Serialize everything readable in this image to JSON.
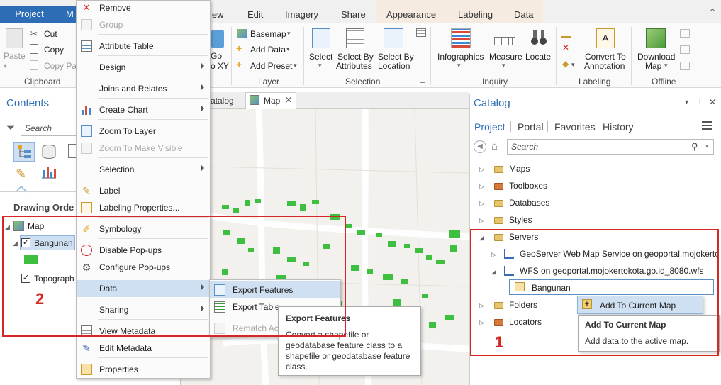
{
  "ribbon": {
    "tabs": {
      "project": "Project",
      "map_partial": "M",
      "view_partial": "iew",
      "edit": "Edit",
      "imagery": "Imagery",
      "share": "Share",
      "appearance": "Appearance",
      "labeling": "Labeling",
      "data": "Data"
    },
    "clipboard": {
      "paste": "Paste",
      "cut": "Cut",
      "copy": "Copy",
      "copy_path": "Copy Pat",
      "group": "Clipboard"
    },
    "navigate": {
      "go_partial": "Go",
      "to_xy_partial": "o XY"
    },
    "layer": {
      "basemap": "Basemap",
      "add_data": "Add Data",
      "add_preset": "Add Preset",
      "group": "Layer"
    },
    "selection": {
      "select": "Select",
      "select_by": "Select By",
      "attributes": "Attributes",
      "location": "Location",
      "group": "Selection"
    },
    "inquiry": {
      "infographics": "Infographics",
      "measure": "Measure",
      "locate": "Locate",
      "group": "Inquiry"
    },
    "labeling": {
      "convert_to": "Convert To",
      "annotation": "Annotation",
      "group": "Labeling"
    },
    "offline": {
      "download": "Download",
      "map": "Map",
      "group": "Offline"
    }
  },
  "contents": {
    "title": "Contents",
    "search_placeholder": "Search",
    "drawing_order": "Drawing Orde",
    "map": "Map",
    "layer_bangunan": "Bangunan",
    "layer_topographic": "Topograph"
  },
  "mapview": {
    "tab_catalog_partial": "atalog",
    "tab_map": "Map"
  },
  "context_menu": {
    "items": [
      {
        "label": "Remove",
        "disabled": false
      },
      {
        "label": "Group",
        "disabled": true
      },
      {
        "label": "Attribute Table",
        "disabled": false
      },
      {
        "label": "Design",
        "disabled": false
      },
      {
        "label": "Joins and Relates",
        "disabled": false
      },
      {
        "label": "Create Chart",
        "disabled": false
      },
      {
        "label": "Zoom To Layer",
        "disabled": false
      },
      {
        "label": "Zoom To Make Visible",
        "disabled": true
      },
      {
        "label": "Selection",
        "disabled": false
      },
      {
        "label": "Label",
        "disabled": false
      },
      {
        "label": "Labeling Properties...",
        "disabled": false
      },
      {
        "label": "Symbology",
        "disabled": false
      },
      {
        "label": "Disable Pop-ups",
        "disabled": false
      },
      {
        "label": "Configure Pop-ups",
        "disabled": false
      },
      {
        "label": "Data",
        "disabled": false
      },
      {
        "label": "Sharing",
        "disabled": false
      },
      {
        "label": "View Metadata",
        "disabled": false
      },
      {
        "label": "Edit Metadata",
        "disabled": false
      },
      {
        "label": "Properties",
        "disabled": false
      }
    ]
  },
  "data_submenu": {
    "export_features": "Export Features",
    "export_table": "Export Table",
    "rematch": "Rematch Ac"
  },
  "tooltip_export": {
    "title": "Export Features",
    "body": [
      "Convert a shapefile or",
      "geodatabase feature class to a",
      "shapefile or geodatabase feature",
      "class."
    ]
  },
  "catalog": {
    "title": "Catalog",
    "tabs": {
      "project": "Project",
      "portal": "Portal",
      "favorites": "Favorites",
      "history": "History"
    },
    "search_placeholder": "Search",
    "items": {
      "maps": "Maps",
      "toolboxes": "Toolboxes",
      "databases": "Databases",
      "styles": "Styles",
      "servers": "Servers",
      "geoserver": "GeoServer Web Map Service on geoportal.mojokertc",
      "wfs": "WFS on geoportal.mojokertokota.go.id_8080.wfs",
      "bangunan": "Bangunan",
      "folders": "Folders",
      "locators": "Locators"
    },
    "add_to_current_map": "Add To Current Map",
    "tooltip_title": "Add To Current Map",
    "tooltip_body": "Add data to the active map."
  },
  "annotations": {
    "label_1": "1",
    "label_2": "2"
  },
  "colors": {
    "accent": "#2d6db5",
    "annotation_red": "#d62626",
    "feature_green": "#3fbf3f"
  }
}
